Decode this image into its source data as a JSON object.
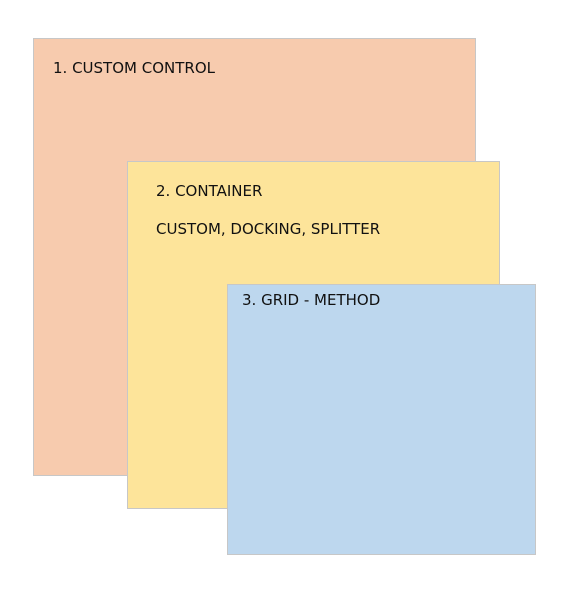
{
  "boxes": [
    {
      "id": "custom-control",
      "title": "1. CUSTOM CONTROL",
      "color": "#f7cbae"
    },
    {
      "id": "container",
      "title": "2. CONTAINER",
      "subtitle": "CUSTOM, DOCKING, SPLITTER",
      "color": "#fde49a"
    },
    {
      "id": "grid-method",
      "title": "3. GRID - METHOD",
      "color": "#bdd7ee"
    }
  ]
}
